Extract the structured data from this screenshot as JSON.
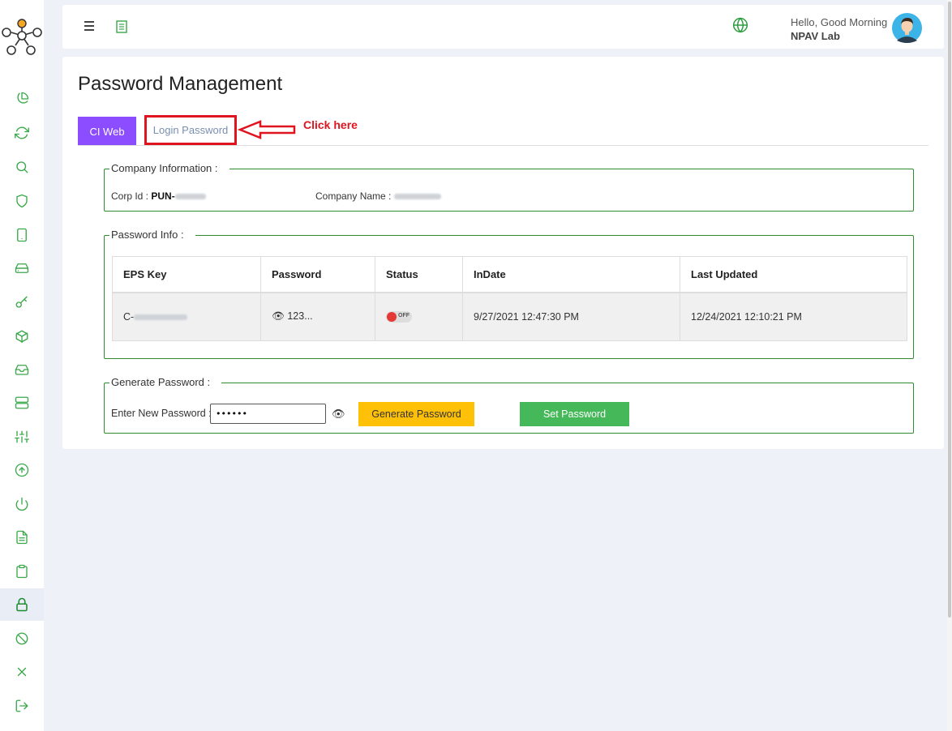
{
  "sidebar": {
    "logo": "molecule-logo",
    "items": [
      {
        "icon": "pie-chart-icon"
      },
      {
        "icon": "refresh-icon"
      },
      {
        "icon": "search-icon"
      },
      {
        "icon": "shield-icon"
      },
      {
        "icon": "tablet-icon"
      },
      {
        "icon": "hard-drive-icon"
      },
      {
        "icon": "key-icon"
      },
      {
        "icon": "package-icon"
      },
      {
        "icon": "inbox-icon"
      },
      {
        "icon": "server-icon"
      },
      {
        "icon": "sliders-icon"
      },
      {
        "icon": "upload-circle-icon"
      },
      {
        "icon": "power-icon"
      },
      {
        "icon": "file-text-icon"
      },
      {
        "icon": "clipboard-icon"
      },
      {
        "icon": "lock-icon",
        "active": true
      },
      {
        "icon": "block-icon"
      },
      {
        "icon": "x-icon"
      },
      {
        "icon": "logout-icon"
      }
    ],
    "accent": "#3aa84a"
  },
  "header": {
    "greeting": "Hello, Good Morning",
    "username": "NPAV Lab"
  },
  "page": {
    "title": "Password Management",
    "tabs": [
      {
        "label": "CI Web",
        "active": true
      },
      {
        "label": "Login Password",
        "highlighted": true
      }
    ],
    "annotation": "Click here"
  },
  "company": {
    "legend": "Company Information :",
    "corp_id_label": "Corp Id : ",
    "corp_id_prefix": "PUN-",
    "company_name_label": "Company Name : "
  },
  "password_info": {
    "legend": "Password Info :",
    "columns": [
      "EPS Key",
      "Password",
      "Status",
      "InDate",
      "Last Updated"
    ],
    "row": {
      "eps_key_prefix": "C-",
      "password": "123...",
      "status": "OFF",
      "indate": "9/27/2021 12:47:30 PM",
      "last_updated": "12/24/2021 12:10:21 PM"
    }
  },
  "generate": {
    "legend": "Generate Password :",
    "input_label": "Enter New Password :",
    "input_value": "••••••",
    "generate_label": "Generate Password",
    "set_label": "Set Password"
  },
  "colors": {
    "tab_active": "#8b4dff",
    "highlight_red": "#e0141e",
    "generate_btn": "#ffc107",
    "set_btn": "#45b85a",
    "fieldset_border": "#2e8b2e"
  }
}
